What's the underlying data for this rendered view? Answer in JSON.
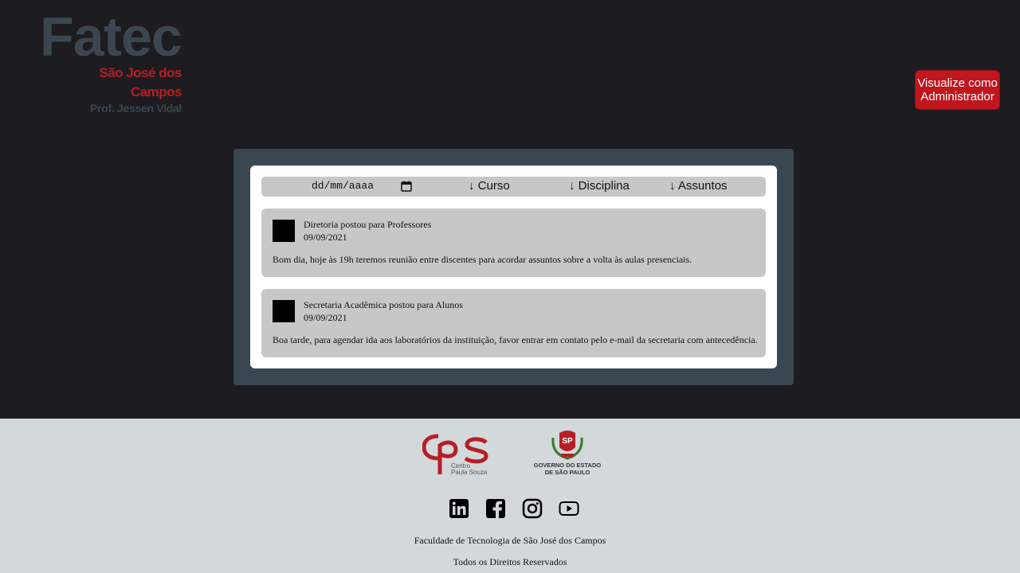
{
  "header": {
    "logo": {
      "main": "Fatec",
      "sub_line1": "São José dos",
      "sub_line2": "Campos",
      "prof": "Prof. Jessen Vidal"
    },
    "admin_button": {
      "line1": "Visualize como",
      "line2": "Administrador"
    }
  },
  "filters": {
    "date_placeholder": "dd/mm/aaaa",
    "curso": "↓ Curso",
    "disciplina": "↓ Disciplina",
    "assuntos": "↓ Assuntos"
  },
  "posts": [
    {
      "author": "Diretoria postou para Professores",
      "date": "09/09/2021",
      "body": "Bom dia, hoje às 19h teremos reunião entre discentes para acordar assuntos sobre a volta às aulas presenciais."
    },
    {
      "author": "Secretaria Acadêmica postou para Alunos",
      "date": "09/09/2021",
      "body": "Boa tarde, para agendar ida aos laboratórios da instituição, favor entrar em contato pelo e-mail da secretaria com antecedência."
    }
  ],
  "footer": {
    "cps_logo": {
      "text_line1": "Centro",
      "text_line2": "Paula Souza"
    },
    "gov_logo": {
      "emblem": "SP",
      "line1": "GOVERNO DO ESTADO",
      "line2": "DE SÃO PAULO"
    },
    "social_icons": [
      "linkedin-icon",
      "facebook-icon",
      "instagram-icon",
      "youtube-icon"
    ],
    "institution": "Faculdade de Tecnologia de São José dos Campos",
    "rights": "Todos os Direitos Reservados"
  },
  "colors": {
    "background": "#1c1c21",
    "panel": "#3b4650",
    "accent_red": "#c0161d",
    "card": "#c7c7c7",
    "footer": "#d3d8db"
  }
}
